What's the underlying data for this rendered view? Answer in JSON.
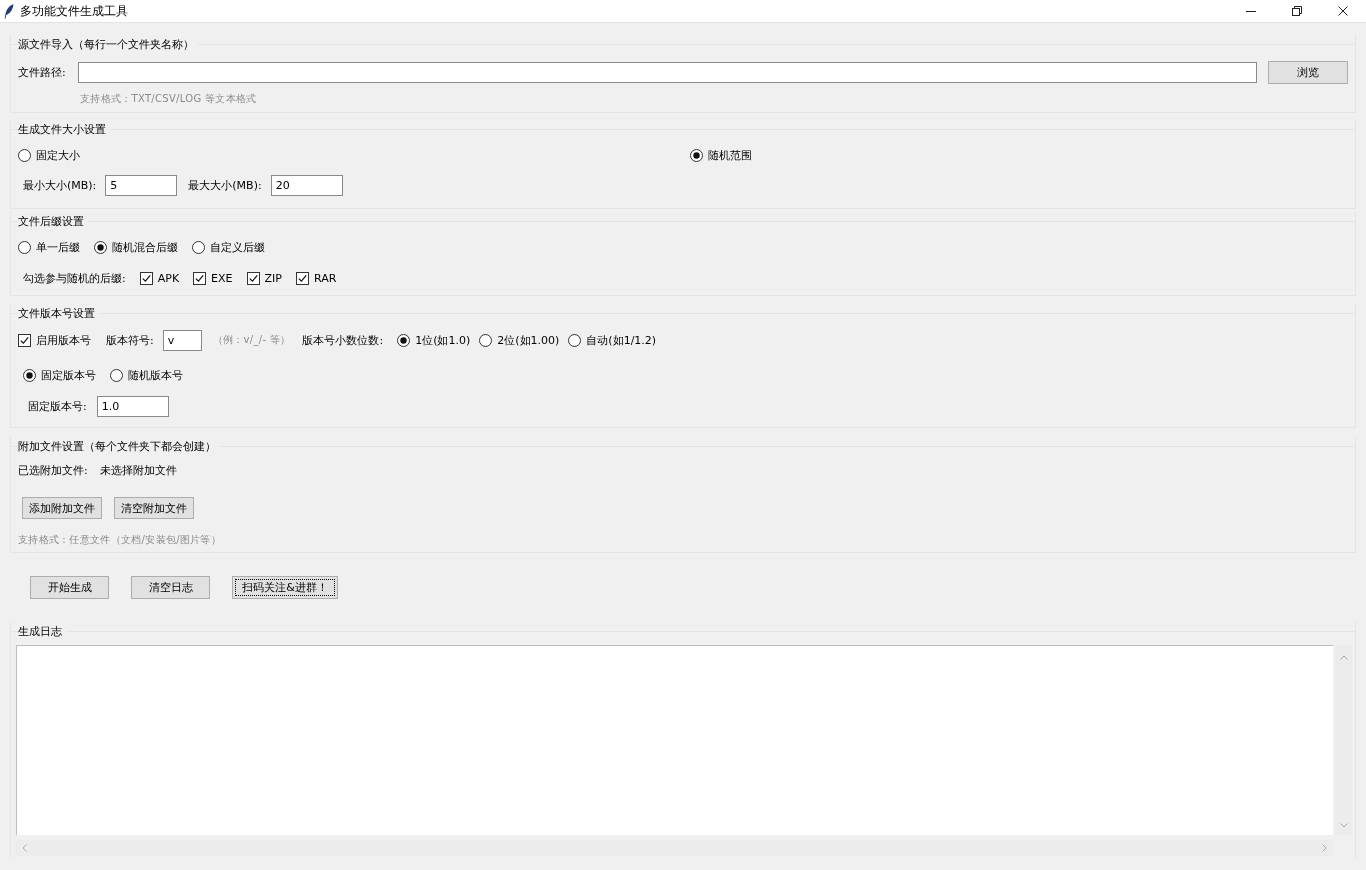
{
  "window": {
    "title": "多功能文件生成工具"
  },
  "source": {
    "title": "源文件导入（每行一个文件夹名称）",
    "path_label": "文件路径:",
    "browse_button": "浏览",
    "hint": "支持格式：TXT/CSV/LOG 等文本格式"
  },
  "size": {
    "title": "生成文件大小设置",
    "modes": [
      {
        "label": "固定大小",
        "selected": false
      },
      {
        "label": "随机范围",
        "selected": true
      }
    ],
    "fields": [
      {
        "label": "最小大小(MB):",
        "value": "5"
      },
      {
        "label": "最大大小(MB):",
        "value": "20"
      }
    ]
  },
  "suffix": {
    "title": "文件后缀设置",
    "modes": [
      {
        "label": "单一后缀",
        "selected": false
      },
      {
        "label": "随机混合后缀",
        "selected": true
      },
      {
        "label": "自定义后缀",
        "selected": false
      }
    ],
    "random_label": "勾选参与随机的后缀:",
    "extensions": [
      {
        "label": "APK",
        "checked": true
      },
      {
        "label": "EXE",
        "checked": true
      },
      {
        "label": "ZIP",
        "checked": true
      },
      {
        "label": "RAR",
        "checked": true
      }
    ]
  },
  "version": {
    "title": "文件版本号设置",
    "enable": {
      "label": "启用版本号",
      "checked": true
    },
    "symbol_label": "版本符号:",
    "symbol_value": "v",
    "symbol_hint": "（例：v/_/- 等）",
    "decimals_label": "版本号小数位数:",
    "decimals": [
      {
        "label": "1位(如1.0)",
        "selected": true
      },
      {
        "label": "2位(如1.00)",
        "selected": false
      },
      {
        "label": "自动(如1/1.2)",
        "selected": false
      }
    ],
    "modes": [
      {
        "label": "固定版本号",
        "selected": true
      },
      {
        "label": "随机版本号",
        "selected": false
      }
    ],
    "fixed_label": "固定版本号:",
    "fixed_value": "1.0"
  },
  "attachments": {
    "title": "附加文件设置（每个文件夹下都会创建）",
    "selected_label": "已选附加文件:",
    "selected_value": "未选择附加文件",
    "buttons": [
      "添加附加文件",
      "清空附加文件"
    ],
    "hint": "支持格式：任意文件（文档/安装包/图片等）"
  },
  "actions": [
    {
      "label": "开始生成",
      "focused": false
    },
    {
      "label": "清空日志",
      "focused": false
    },
    {
      "label": "扫码关注&进群！",
      "focused": true
    }
  ],
  "log": {
    "title": "生成日志"
  }
}
